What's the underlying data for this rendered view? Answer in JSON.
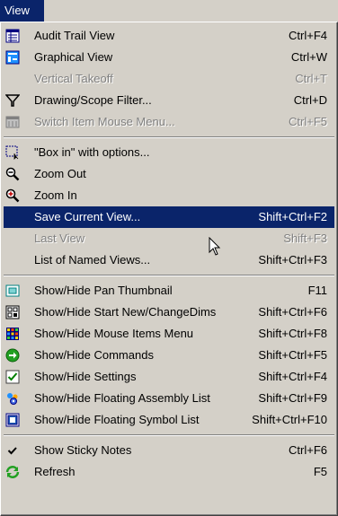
{
  "menubar": {
    "title": "View"
  },
  "menu": {
    "items": [
      {
        "label": "Audit Trail View",
        "accel": "Ctrl+F4",
        "icon": "audit-trail-icon"
      },
      {
        "label": "Graphical View",
        "accel": "Ctrl+W",
        "icon": "graphical-view-icon"
      },
      {
        "label": "Vertical Takeoff",
        "accel": "Ctrl+T",
        "icon": "",
        "disabled": true
      },
      {
        "label": "Drawing/Scope Filter...",
        "accel": "Ctrl+D",
        "icon": "filter-icon"
      },
      {
        "label": "Switch Item Mouse Menu...",
        "accel": "Ctrl+F5",
        "icon": "switch-menu-icon",
        "disabled": true
      },
      {
        "label": "\"Box in\" with options...",
        "accel": "",
        "icon": "box-in-icon"
      },
      {
        "label": "Zoom Out",
        "accel": "",
        "icon": "zoom-out-icon"
      },
      {
        "label": "Zoom In",
        "accel": "",
        "icon": "zoom-in-icon"
      },
      {
        "label": "Save Current View...",
        "accel": "Shift+Ctrl+F2",
        "icon": "",
        "selected": true
      },
      {
        "label": "Last View",
        "accel": "Shift+F3",
        "icon": "",
        "disabled": true
      },
      {
        "label": "List of Named Views...",
        "accel": "Shift+Ctrl+F3",
        "icon": ""
      },
      {
        "label": "Show/Hide Pan Thumbnail",
        "accel": "F11",
        "icon": "pan-thumbnail-icon"
      },
      {
        "label": "Show/Hide Start New/ChangeDims",
        "accel": "Shift+Ctrl+F6",
        "icon": "start-new-icon"
      },
      {
        "label": "Show/Hide Mouse Items Menu",
        "accel": "Shift+Ctrl+F8",
        "icon": "mouse-items-icon"
      },
      {
        "label": "Show/Hide Commands",
        "accel": "Shift+Ctrl+F5",
        "icon": "commands-icon"
      },
      {
        "label": "Show/Hide Settings",
        "accel": "Shift+Ctrl+F4",
        "icon": "settings-check-icon"
      },
      {
        "label": "Show/Hide Floating Assembly List",
        "accel": "Shift+Ctrl+F9",
        "icon": "assembly-list-icon"
      },
      {
        "label": "Show/Hide Floating Symbol List",
        "accel": "Shift+Ctrl+F10",
        "icon": "symbol-list-icon"
      },
      {
        "label": "Show Sticky Notes",
        "accel": "Ctrl+F6",
        "icon": "checkmark-icon"
      },
      {
        "label": "Refresh",
        "accel": "F5",
        "icon": "refresh-icon"
      }
    ]
  },
  "colors": {
    "menu_bg": "#d4d0c8",
    "highlight": "#0a246a",
    "disabled_text": "#808080"
  }
}
